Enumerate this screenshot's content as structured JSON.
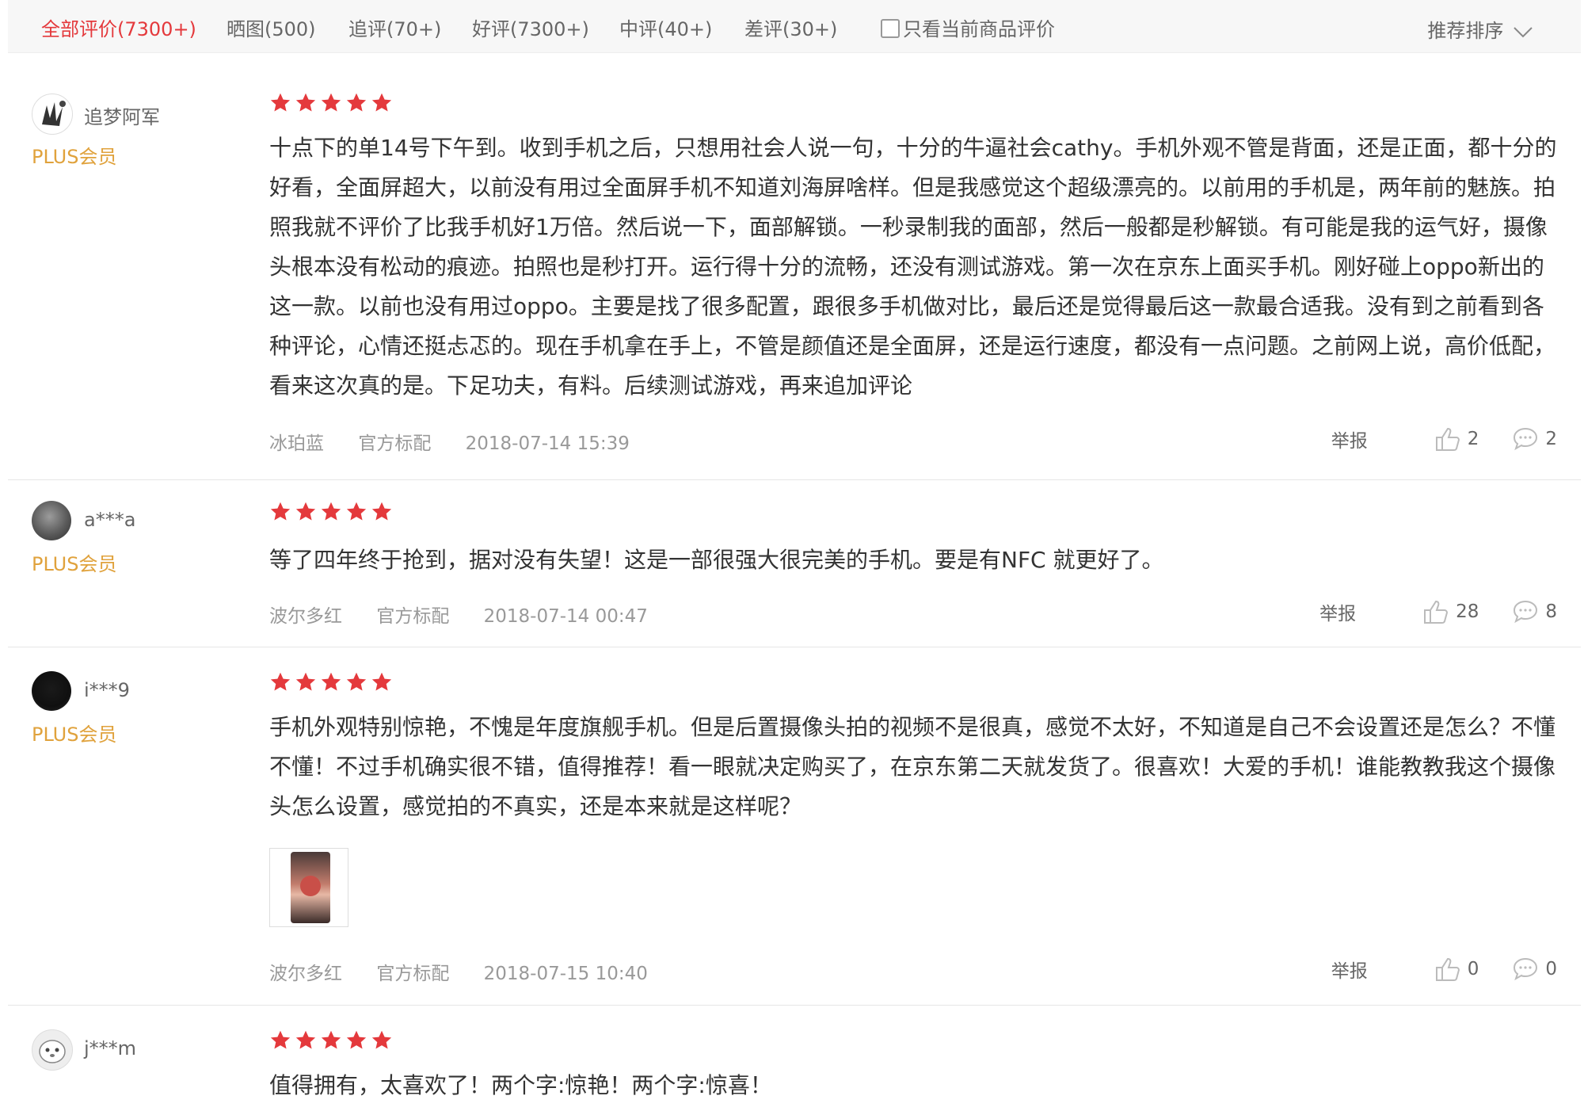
{
  "filters": {
    "tabs": [
      {
        "label": "全部评价(7300+)",
        "active": true
      },
      {
        "label": "晒图(500)",
        "active": false
      },
      {
        "label": "追评(70+)",
        "active": false
      },
      {
        "label": "好评(7300+)",
        "active": false
      },
      {
        "label": "中评(40+)",
        "active": false
      },
      {
        "label": "差评(30+)",
        "active": false
      }
    ],
    "only_current_label": "只看当前商品评价",
    "sort_label": "推荐排序"
  },
  "rating_color": "#e4393c",
  "accent_color": "#e4393c",
  "member_color": "#e0a23c",
  "reviews": [
    {
      "nickname": "追梦阿军",
      "level": "PLUS会员",
      "stars": 5,
      "content": "十点下的单14号下午到。收到手机之后，只想用社会人说一句，十分的牛逼社会cathy。手机外观不管是背面，还是正面，都十分的好看，全面屏超大，以前没有用过全面屏手机不知道刘海屏啥样。但是我感觉这个超级漂亮的。以前用的手机是，两年前的魅族。拍照我就不评价了比我手机好1万倍。然后说一下，面部解锁。一秒录制我的面部，然后一般都是秒解锁。有可能是我的运气好，摄像头根本没有松动的痕迹。拍照也是秒打开。运行得十分的流畅，还没有测试游戏。第一次在京东上面买手机。刚好碰上oppo新出的这一款。以前也没有用过oppo。主要是找了很多配置，跟很多手机做对比，最后还是觉得最后这一款最合适我。没有到之前看到各种评论，心情还挺忐忑的。现在手机拿在手上，不管是颜值还是全面屏，还是运行速度，都没有一点问题。之前网上说，高价低配，看来这次真的是。下足功夫，有料。后续测试游戏，再来追加评论",
      "color": "冰珀蓝",
      "package": "官方标配",
      "date": "2018-07-14 15:39",
      "report": "举报",
      "likes": "2",
      "replies": "2"
    },
    {
      "nickname": "a***a",
      "level": "PLUS会员",
      "stars": 5,
      "content": "等了四年终于抢到，据对没有失望！这是一部很强大很完美的手机。要是有NFC 就更好了。",
      "color": "波尔多红",
      "package": "官方标配",
      "date": "2018-07-14 00:47",
      "report": "举报",
      "likes": "28",
      "replies": "8"
    },
    {
      "nickname": "i***9",
      "level": "PLUS会员",
      "stars": 5,
      "content": "手机外观特别惊艳，不愧是年度旗舰手机。但是后置摄像头拍的视频不是很真，感觉不太好，不知道是自己不会设置还是怎么？不懂不懂！不过手机确实很不错，值得推荐！看一眼就决定购买了，在京东第二天就发货了。很喜欢！大爱的手机！谁能教教我这个摄像头怎么设置，感觉拍的不真实，还是本来就是这样呢？",
      "color": "波尔多红",
      "package": "官方标配",
      "date": "2018-07-15 10:40",
      "report": "举报",
      "likes": "0",
      "replies": "0"
    },
    {
      "nickname": "j***m",
      "level": "",
      "stars": 5,
      "content": "值得拥有，太喜欢了！两个字:惊艳！两个字:惊喜！"
    }
  ]
}
